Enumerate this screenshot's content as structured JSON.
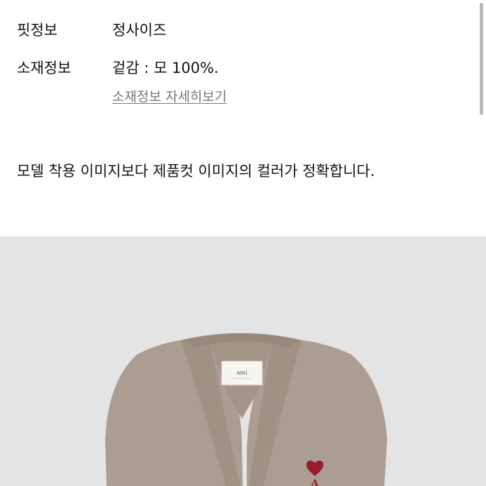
{
  "info": {
    "fit_label": "핏정보",
    "fit_value": "정사이즈",
    "material_label": "소재정보",
    "material_value": "겉감 : 모 100%.",
    "material_detail_link": "소재정보 자세히보기"
  },
  "notice": "모델 착용 이미지보다 제품컷 이미지의 컬러가 정확합니다.",
  "product_image": {
    "subject": "cardigan",
    "label_text": "ami",
    "colors": {
      "background": "#e4e4e4",
      "knit": "#ab9d91",
      "rib": "#9f9184",
      "logo": "#9b1c2c"
    }
  }
}
